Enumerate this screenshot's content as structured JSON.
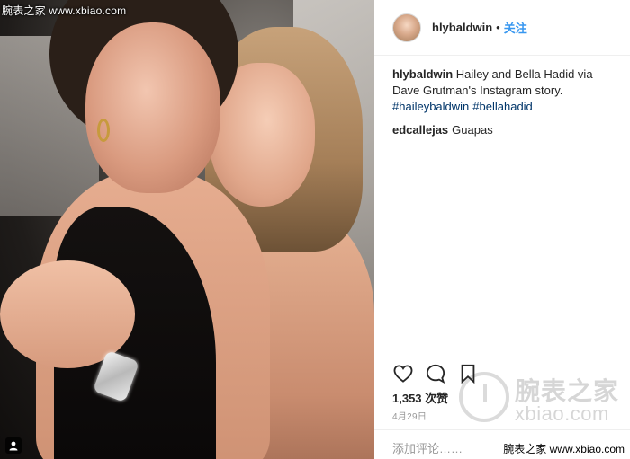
{
  "watermark_top": "腕表之家 www.xbiao.com",
  "watermark_bottom": "腕表之家 www.xbiao.com",
  "brand_watermark": {
    "cn": "腕表之家",
    "en": "xbiao.com"
  },
  "post": {
    "username": "hlybaldwin",
    "separator": "•",
    "follow_label": "关注",
    "caption_user": "hlybaldwin",
    "caption_text": "Hailey and Bella Hadid via Dave Grutman's Instagram story.",
    "hashtags": [
      "#haileybaldwin",
      "#bellahadid"
    ],
    "comment": {
      "user": "edcallejas",
      "text": "Guapas"
    },
    "likes": "1,353 次赞",
    "date": "4月29日",
    "comment_placeholder": "添加评论……"
  },
  "icons": {
    "like": "heart-icon",
    "comment": "comment-bubble-icon",
    "save": "bookmark-icon",
    "tagged": "user-tag-icon"
  },
  "colors": {
    "link": "#3897f0",
    "hashtag": "#003569",
    "muted": "#999999",
    "text": "#262626"
  }
}
